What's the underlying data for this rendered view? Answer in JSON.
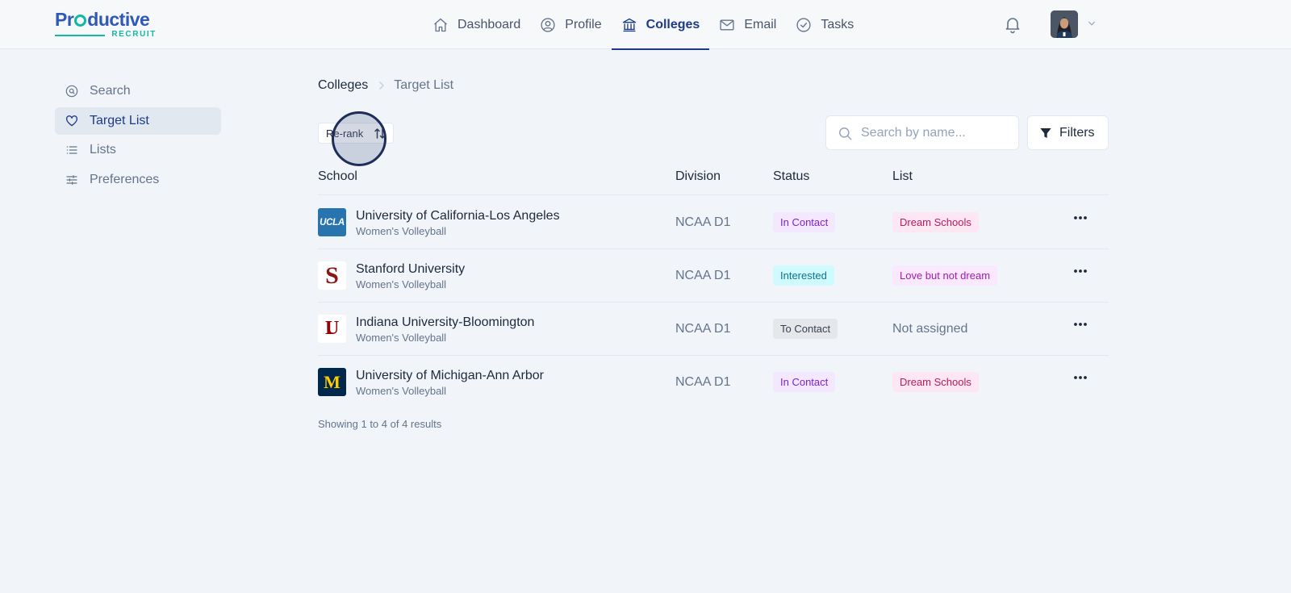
{
  "brand": {
    "name_pre": "Pr",
    "name_post": "ductive",
    "tagline": "RECRUIT"
  },
  "nav": {
    "items": [
      {
        "label": "Dashboard",
        "icon": "home-icon"
      },
      {
        "label": "Profile",
        "icon": "user-circle-icon"
      },
      {
        "label": "Colleges",
        "icon": "bank-icon",
        "active": true
      },
      {
        "label": "Email",
        "icon": "mail-icon"
      },
      {
        "label": "Tasks",
        "icon": "check-circle-icon"
      }
    ]
  },
  "sidebar": {
    "items": [
      {
        "label": "Search",
        "icon": "search-circle-icon"
      },
      {
        "label": "Target List",
        "icon": "heart-icon",
        "active": true
      },
      {
        "label": "Lists",
        "icon": "list-icon"
      },
      {
        "label": "Preferences",
        "icon": "sliders-icon"
      }
    ]
  },
  "breadcrumb": {
    "parent": "Colleges",
    "current": "Target List"
  },
  "toolbar": {
    "rerank_label": "Re-rank",
    "search_placeholder": "Search by name...",
    "filters_label": "Filters"
  },
  "table": {
    "columns": {
      "school": "School",
      "division": "Division",
      "status": "Status",
      "list": "List"
    },
    "rows": [
      {
        "name": "University of California-Los Angeles",
        "sport": "Women's Volleyball",
        "logo_text": "UCLA",
        "logo_bg": "#2774ae",
        "division": "NCAA D1",
        "status": "In Contact",
        "list": "Dream Schools"
      },
      {
        "name": "Stanford University",
        "sport": "Women's Volleyball",
        "logo_text": "S",
        "logo_bg": "#ffffff",
        "division": "NCAA D1",
        "status": "Interested",
        "list": "Love but not dream"
      },
      {
        "name": "Indiana University-Bloomington",
        "sport": "Women's Volleyball",
        "logo_text": "IU",
        "logo_bg": "#ffffff",
        "division": "NCAA D1",
        "status": "To Contact",
        "list": "Not assigned"
      },
      {
        "name": "University of Michigan-Ann Arbor",
        "sport": "Women's Volleyball",
        "logo_text": "M",
        "logo_bg": "#00274c",
        "division": "NCAA D1",
        "status": "In Contact",
        "list": "Dream Schools"
      }
    ]
  },
  "footer": {
    "results": "Showing 1 to 4 of 4 results"
  }
}
